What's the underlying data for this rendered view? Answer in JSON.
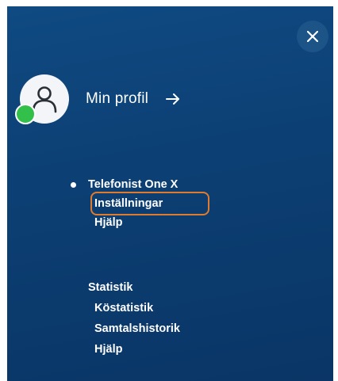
{
  "profile": {
    "label": "Min profil"
  },
  "menu": {
    "groups": [
      {
        "title": "Telefonist One X",
        "active": true,
        "items": [
          "Inställningar",
          "Hjälp"
        ]
      },
      {
        "title": "Statistik",
        "active": false,
        "items": [
          "Köstatistik",
          "Samtalshistorik",
          "Hjälp"
        ]
      }
    ],
    "highlighted_item": "Inställningar"
  },
  "colors": {
    "panel_background": "#0c3f73",
    "presence_online": "#33c04a",
    "highlight_outline": "#e07b2e"
  },
  "icons": {
    "close": "close-icon",
    "avatar": "user-icon",
    "arrow": "arrow-right-icon",
    "bullet": "bullet-icon"
  }
}
